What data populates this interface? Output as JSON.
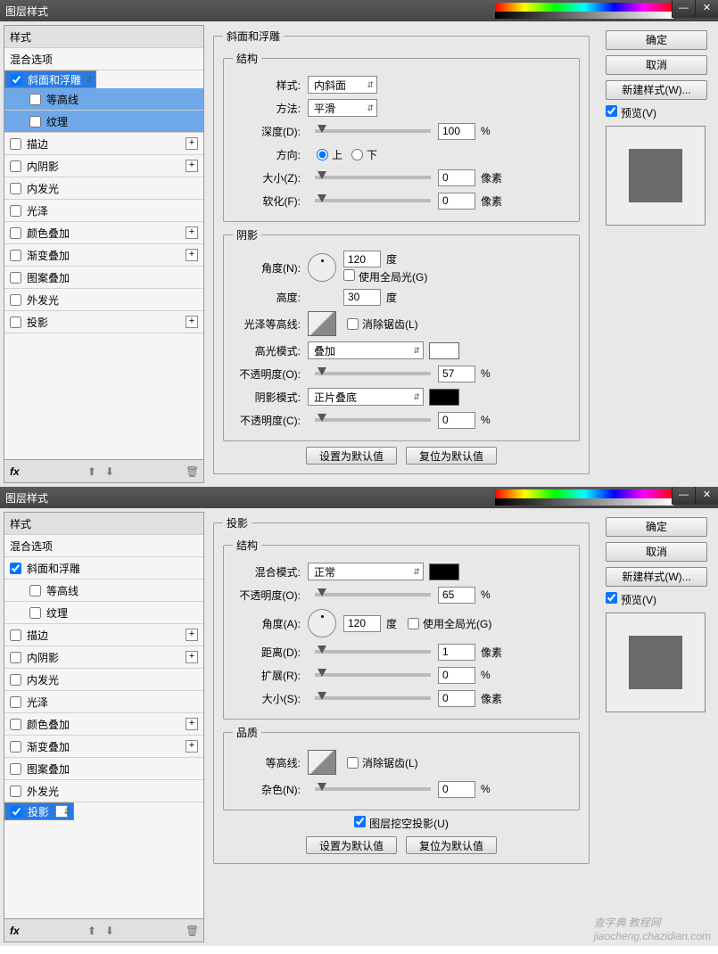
{
  "common": {
    "title": "图层样式",
    "styleHdr": "样式",
    "blendOpts": "混合选项",
    "bevel": "斜面和浮雕",
    "contour": "等高线",
    "texture": "纹理",
    "stroke": "描边",
    "innerShadow": "内阴影",
    "innerGlow": "内发光",
    "satin": "光泽",
    "colorOverlay": "颜色叠加",
    "gradOverlay": "渐变叠加",
    "patOverlay": "图案叠加",
    "outerGlow": "外发光",
    "dropShadow": "投影",
    "fx": "fx",
    "up": "⬆",
    "down": "⬇",
    "trash": "🗑",
    "ok": "确定",
    "cancel": "取消",
    "newStyle": "新建样式(W)...",
    "previewLbl": "预览(V)",
    "makeDefault": "设置为默认值",
    "resetDefault": "复位为默认值"
  },
  "d1": {
    "panel": "斜面和浮雕",
    "structure": "结构",
    "styleLbl": "样式:",
    "styleVal": "内斜面",
    "methodLbl": "方法:",
    "methodVal": "平滑",
    "depthLbl": "深度(D):",
    "depthVal": "100",
    "pct": "%",
    "dirLbl": "方向:",
    "dirUp": "上",
    "dirDown": "下",
    "sizeLbl": "大小(Z):",
    "sizeVal": "0",
    "px": "像素",
    "softenLbl": "软化(F):",
    "softenVal": "0",
    "shading": "阴影",
    "angleLbl": "角度(N):",
    "angleVal": "120",
    "deg": "度",
    "globalLight": "使用全局光(G)",
    "altLbl": "高度:",
    "altVal": "30",
    "glossLbl": "光泽等高线:",
    "antiAlias": "消除锯齿(L)",
    "hiModeLbl": "高光模式:",
    "hiModeVal": "叠加",
    "opacityLbl": "不透明度(O):",
    "hiOpVal": "57",
    "shModeLbl": "阴影模式:",
    "shModeVal": "正片叠底",
    "opacityCLbl": "不透明度(C):",
    "shOpVal": "0"
  },
  "d2": {
    "panel": "投影",
    "structure": "结构",
    "blendLbl": "混合模式:",
    "blendVal": "正常",
    "opacityLbl": "不透明度(O):",
    "opVal": "65",
    "pct": "%",
    "angleLbl": "角度(A):",
    "angleVal": "120",
    "deg": "度",
    "globalLight": "使用全局光(G)",
    "distLbl": "距离(D):",
    "distVal": "1",
    "px": "像素",
    "spreadLbl": "扩展(R):",
    "spreadVal": "0",
    "sizeLbl": "大小(S):",
    "sizeVal": "0",
    "quality": "品质",
    "contourLbl": "等高线:",
    "antiAlias": "消除锯齿(L)",
    "noiseLbl": "杂色(N):",
    "noiseVal": "0",
    "knockout": "图层挖空投影(U)"
  },
  "watermark1": "查字典",
  "watermark2": "教程网",
  "watermark3": "jiaocheng.chazidian.com"
}
